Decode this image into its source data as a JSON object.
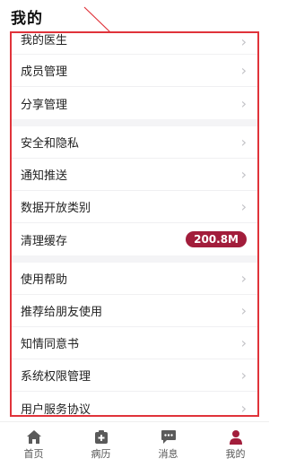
{
  "header": {
    "title": "我的"
  },
  "menu": {
    "group1": [
      {
        "label": "我的医生"
      },
      {
        "label": "成员管理"
      },
      {
        "label": "分享管理"
      }
    ],
    "group2": [
      {
        "label": "安全和隐私"
      },
      {
        "label": "通知推送"
      },
      {
        "label": "数据开放类别"
      },
      {
        "label": "清理缓存",
        "value": "200.8M"
      }
    ],
    "group3": [
      {
        "label": "使用帮助"
      },
      {
        "label": "推荐给朋友使用"
      },
      {
        "label": "知情同意书"
      },
      {
        "label": "系统权限管理"
      },
      {
        "label": "用户服务协议"
      }
    ]
  },
  "tabbar": {
    "items": [
      {
        "label": "首页",
        "icon": "home-icon"
      },
      {
        "label": "病历",
        "icon": "medical-record-icon"
      },
      {
        "label": "消息",
        "icon": "message-icon"
      },
      {
        "label": "我的",
        "icon": "person-icon",
        "active": true
      }
    ]
  },
  "colors": {
    "highlight_border": "#e0333a",
    "badge_bg": "#a21d3b",
    "icon_inactive": "#5a5a5a",
    "icon_active": "#a21d3b"
  }
}
